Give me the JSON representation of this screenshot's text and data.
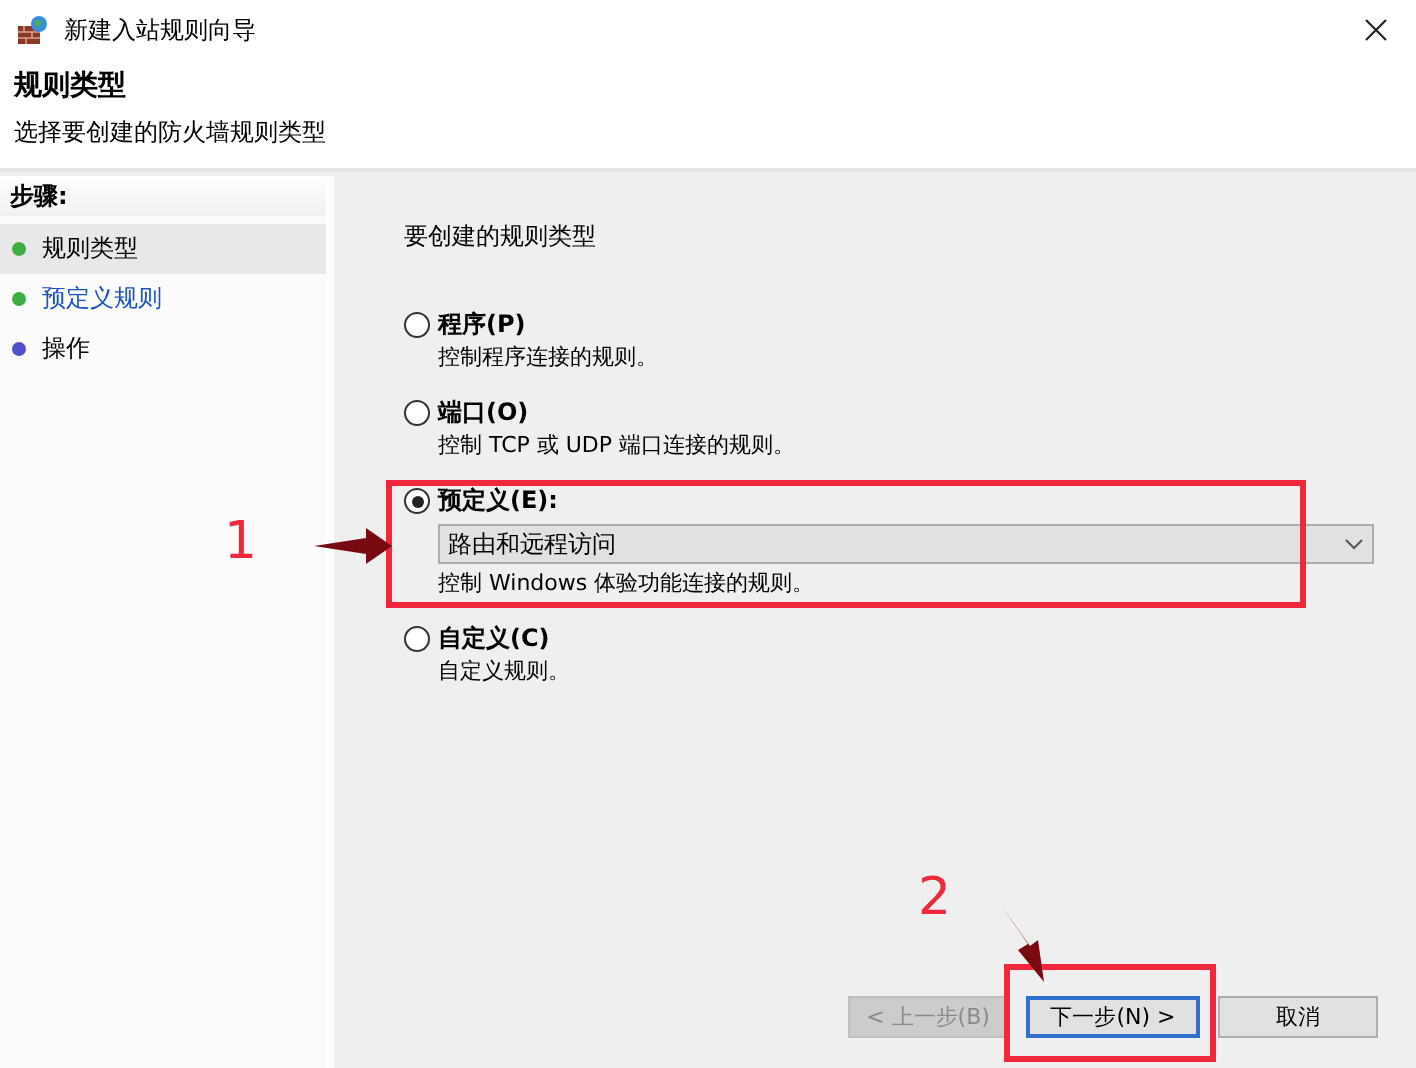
{
  "window": {
    "title": "新建入站规则向导"
  },
  "header": {
    "title": "规则类型",
    "subtitle": "选择要创建的防火墙规则类型"
  },
  "steps": {
    "heading": "步骤:",
    "items": [
      {
        "label": "规则类型",
        "selected": true,
        "link": false,
        "color": "#3cb043"
      },
      {
        "label": "预定义规则",
        "selected": false,
        "link": true,
        "color": "#3cb043"
      },
      {
        "label": "操作",
        "selected": false,
        "link": false,
        "color": "#5050c8"
      }
    ]
  },
  "prompt": "要创建的规则类型",
  "options": [
    {
      "label": "程序(P)",
      "description": "控制程序连接的规则。",
      "selected": false
    },
    {
      "label": "端口(O)",
      "description": "控制 TCP 或 UDP 端口连接的规则。",
      "selected": false
    },
    {
      "label": "预定义(E):",
      "dropdown": "路由和远程访问",
      "description": "控制 Windows 体验功能连接的规则。",
      "selected": true
    },
    {
      "label": "自定义(C)",
      "description": "自定义规则。",
      "selected": false
    }
  ],
  "buttons": [
    {
      "label": "< 上一步(B)",
      "disabled": true,
      "focused": false
    },
    {
      "label": "下一步(N) >",
      "disabled": false,
      "focused": true
    },
    {
      "label": "取消",
      "disabled": false,
      "focused": false
    }
  ],
  "annotations": [
    {
      "label": "1"
    },
    {
      "label": "2"
    }
  ]
}
